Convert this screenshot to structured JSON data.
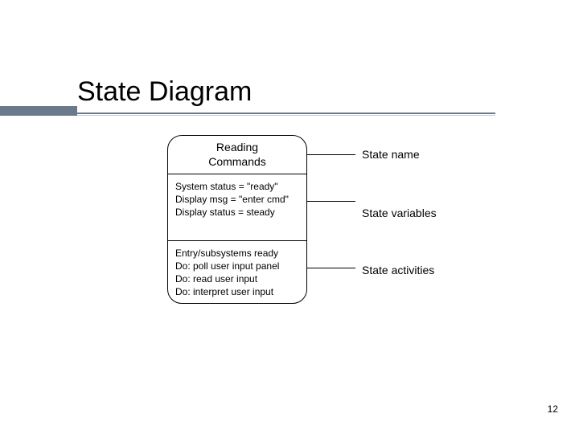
{
  "title": "State Diagram",
  "state": {
    "name_line1": "Reading",
    "name_line2": "Commands",
    "variables": {
      "line1": "System status = \"ready\"",
      "line2": "Display msg = \"enter cmd\"",
      "line3": "Display status = steady"
    },
    "activities": {
      "line1": "Entry/subsystems ready",
      "line2": "Do: poll user input panel",
      "line3": "Do: read user input",
      "line4": "Do: interpret user input"
    }
  },
  "labels": {
    "name": "State name",
    "variables": "State variables",
    "activities": "State activities"
  },
  "page_number": "12"
}
